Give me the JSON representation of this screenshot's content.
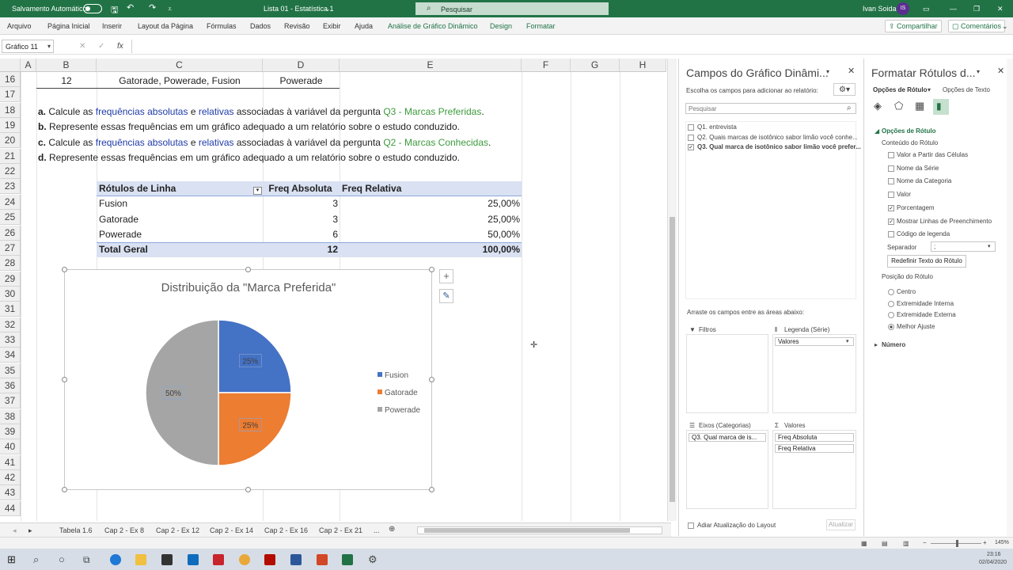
{
  "titlebar": {
    "autosave": "Salvamento Automático",
    "doc_title": "Lista 01 - Estatística 1",
    "search_placeholder": "Pesquisar",
    "user": "Ivan Soida",
    "initials": "IS"
  },
  "ribbon": {
    "tabs": [
      "Arquivo",
      "Página Inicial",
      "Inserir",
      "Layout da Página",
      "Fórmulas",
      "Dados",
      "Revisão",
      "Exibir",
      "Ajuda",
      "Análise de Gráfico Dinâmico",
      "Design",
      "Formatar"
    ],
    "share": "Compartilhar",
    "comments": "Comentários"
  },
  "formula_bar": {
    "name_box": "Gráfico 11",
    "fx": "fx"
  },
  "columns": [
    "A",
    "B",
    "C",
    "D",
    "E",
    "F",
    "G",
    "H"
  ],
  "rows": [
    "16",
    "17",
    "18",
    "19",
    "20",
    "21",
    "22",
    "23",
    "24",
    "25",
    "26",
    "27",
    "28",
    "29",
    "30",
    "31",
    "32",
    "33",
    "34",
    "35",
    "36",
    "37",
    "38",
    "39",
    "40",
    "41",
    "42",
    "43",
    "44"
  ],
  "row16": {
    "b": "12",
    "c": "Gatorade, Powerade, Fusion",
    "d": "Powerade"
  },
  "questions": {
    "a": {
      "label": "a.",
      "p1": "Calcule as ",
      "w1": "frequências absolutas",
      "p2": " e ",
      "w2": "relativas",
      "p3": " associadas à variável da pergunta ",
      "w3": "Q3 - Marcas Preferidas",
      "p4": "."
    },
    "b": {
      "label": "b.",
      "text": "Represente essas frequências em um gráfico adequado a um relatório sobre o estudo conduzido."
    },
    "c": {
      "label": "c.",
      "p1": "Calcule as ",
      "w1": "frequências absolutas",
      "p2": " e ",
      "w2": "relativas",
      "p3": " associadas à variável da pergunta ",
      "w3": "Q2 - Marcas Conhecidas",
      "p4": "."
    },
    "d": {
      "label": "d.",
      "text": "Represente essas frequências em um gráfico adequado a um relatório sobre o estudo conduzido."
    }
  },
  "pivot": {
    "headers": [
      "Rótulos de Linha",
      "Freq Absoluta",
      "Freq Relativa"
    ],
    "rows": [
      {
        "label": "Fusion",
        "abs": "3",
        "rel": "25,00%"
      },
      {
        "label": "Gatorade",
        "abs": "3",
        "rel": "25,00%"
      },
      {
        "label": "Powerade",
        "abs": "6",
        "rel": "50,00%"
      }
    ],
    "total": {
      "label": "Total Geral",
      "abs": "12",
      "rel": "100,00%"
    }
  },
  "chart_data": {
    "type": "pie",
    "title": "Distribuição da \"Marca Preferida\"",
    "categories": [
      "Fusion",
      "Gatorade",
      "Powerade"
    ],
    "values": [
      25,
      25,
      50
    ],
    "labels": [
      "25%",
      "25%",
      "50%"
    ],
    "colors": [
      "#4472c4",
      "#ed7d31",
      "#a5a5a5"
    ],
    "legend": "right"
  },
  "fields_panel": {
    "title": "Campos do Gráfico Dinâmi...",
    "subtitle": "Escolha os campos para adicionar ao relatório:",
    "search": "Pesquisar",
    "fields": [
      {
        "label": "Q1. entrevista",
        "checked": ""
      },
      {
        "label": "Q2. Quais marcas de isotônico sabor limão você conhe...",
        "checked": ""
      },
      {
        "label": "Q3. Qual marca de isotônico sabor limão você prefer...",
        "checked": "✓"
      }
    ],
    "drag_label": "Arraste os campos entre as áreas abaixo:",
    "filters": "Filtros",
    "legend": "Legenda (Série)",
    "legend_item": "Valores",
    "axes": "Eixos (Categorias)",
    "axes_item": "Q3. Qual marca de is...",
    "values": "Valores",
    "values_items": [
      "Freq Absoluta",
      "Freq Relativa"
    ],
    "defer": "Adiar Atualização do Layout",
    "update": "Atualizar"
  },
  "format_panel": {
    "title": "Formatar Rótulos d...",
    "tab1": "Opções de Rótulo",
    "tab2": "Opções de Texto",
    "section": "Opções de Rótulo",
    "content_label": "Conteúdo do Rótulo",
    "options": [
      {
        "label": "Valor a Partir das Células",
        "checked": ""
      },
      {
        "label": "Nome da Série",
        "checked": ""
      },
      {
        "label": "Nome da Categoria",
        "checked": ""
      },
      {
        "label": "Valor",
        "checked": ""
      },
      {
        "label": "Porcentagem",
        "checked": "✓"
      },
      {
        "label": "Mostrar Linhas de Preenchimento",
        "checked": "✓"
      },
      {
        "label": "Código de legenda",
        "checked": ""
      }
    ],
    "separator_label": "Separador",
    "separator_value": ";",
    "reset": "Redefinir Texto do Rótulo",
    "position_label": "Posição do Rótulo",
    "positions": [
      {
        "label": "Centro",
        "selected": false
      },
      {
        "label": "Extremidade Interna",
        "selected": false
      },
      {
        "label": "Extremidade Externa",
        "selected": false
      },
      {
        "label": "Melhor Ajuste",
        "selected": true
      }
    ],
    "number": "Número"
  },
  "sheets": [
    "Tabela 1.6",
    "Cap 2 - Ex 8",
    "Cap 2 - Ex 12",
    "Cap 2 - Ex 14",
    "Cap 2 - Ex 16",
    "Cap 2 - Ex 21",
    "..."
  ],
  "status": {
    "zoom": "145%"
  },
  "taskbar": {
    "time": "23:16",
    "date": "02/04/2020"
  }
}
